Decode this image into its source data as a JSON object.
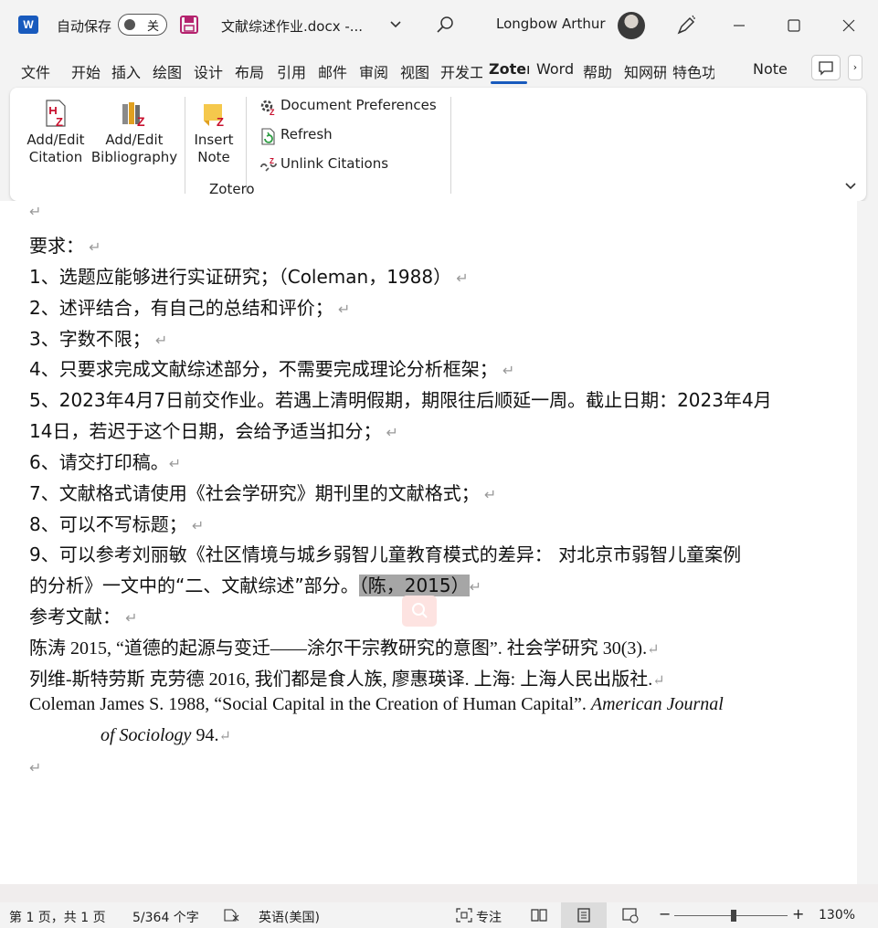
{
  "titlebar": {
    "autosave_label": "自动保存",
    "autosave_state": "关",
    "document_title": "文献综述作业.docx  -...",
    "user_name": "Longbow Arthur"
  },
  "tabs": [
    "文件",
    "开始",
    "插入",
    "绘图",
    "设计",
    "布局",
    "引用",
    "邮件",
    "审阅",
    "视图",
    "开发工",
    "Zotero",
    "Word",
    "帮助",
    "知网研",
    "特色功",
    "Note"
  ],
  "active_tab": "Zotero",
  "ribbon": {
    "add_edit_citation": [
      "Add/Edit",
      "Citation"
    ],
    "add_edit_bibliography": [
      "Add/Edit",
      "Bibliography"
    ],
    "insert_note": [
      "Insert",
      "Note"
    ],
    "document_preferences": "Document Preferences",
    "refresh": "Refresh",
    "unlink_citations": "Unlink Citations",
    "group_label": "Zotero"
  },
  "document": {
    "lines": [
      "要求：",
      "1、选题应能够进行实证研究；（Coleman，1988）",
      "2、述评结合，有自己的总结和评价；",
      "3、字数不限；",
      "4、只要求完成文献综述部分，不需要完成理论分析框架；",
      "5、2023年4月7日前交作业。若遇上清明假期，期限往后顺延一周。截止日期：2023年4月",
      "14日，若迟于这个日期，会给予适当扣分；",
      "6、请交打印稿。",
      "7、文献格式请使用《社会学研究》期刊里的文献格式；",
      "8、可以不写标题；",
      "9、可以参考刘丽敏《社区情境与城乡弱智儿童教育模式的差异： 对北京市弱智儿童案例",
      "的分析》一文中的“二、文献综述”部分。",
      "参考文献：",
      "陈涛 2015, “道德的起源与变迁——涂尔干宗教研究的意图”. 社会学研究 30(3).",
      "列维-斯特劳斯 克劳德 2016, 我们都是食人族, 廖惠瑛译. 上海: 上海人民出版社.",
      "Coleman James S. 1988, “Social Capital in the Creation of Human Capital”. "
    ],
    "highlighted_citation": "（陈，2015）",
    "coleman_journal_italic": "American Journal",
    "coleman_journal_cont": "of Sociology",
    "coleman_volume": " 94."
  },
  "statusbar": {
    "page": "第 1 页，共 1 页",
    "words": "5/364 个字",
    "language": "英语(美国)",
    "focus": "专注",
    "zoom": "130%",
    "zoom_percent": 130
  }
}
